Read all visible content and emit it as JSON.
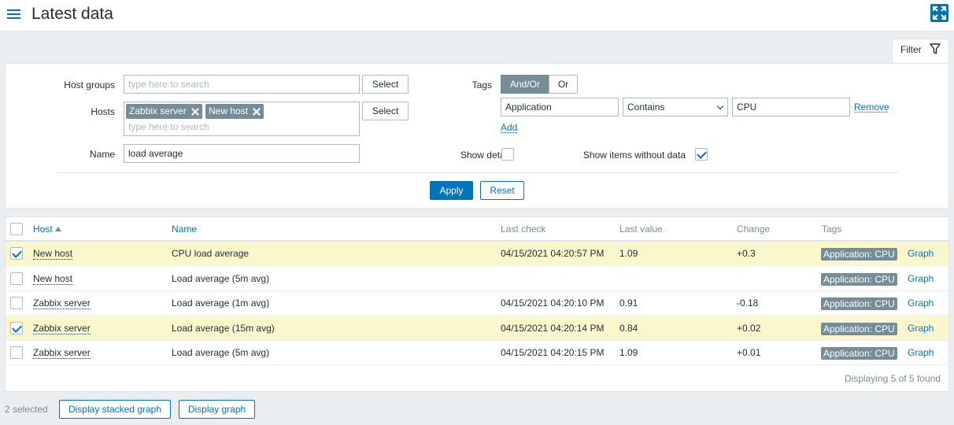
{
  "header": {
    "title": "Latest data",
    "menu_icon": "hamburger-menu-icon",
    "kiosk_icon": "fullscreen-icon"
  },
  "filter_tab": {
    "label": "Filter",
    "icon": "funnel-icon"
  },
  "filter": {
    "host_groups": {
      "label": "Host groups",
      "placeholder": "type here to search",
      "select_label": "Select"
    },
    "hosts": {
      "label": "Hosts",
      "chips": [
        "Zabbix server",
        "New host"
      ],
      "placeholder": "type here to search",
      "select_label": "Select"
    },
    "name": {
      "label": "Name",
      "value": "load average"
    },
    "tags": {
      "label": "Tags",
      "andor_label": "And/Or",
      "or_label": "Or",
      "row": {
        "tag": "Application",
        "operator": "Contains",
        "value": "CPU",
        "remove_label": "Remove"
      },
      "add_label": "Add"
    },
    "show_details": {
      "label": "Show details",
      "checked": false
    },
    "show_items_without_data": {
      "label": "Show items without data",
      "checked": true
    },
    "apply_label": "Apply",
    "reset_label": "Reset"
  },
  "table": {
    "columns": {
      "host": "Host",
      "name": "Name",
      "last_check": "Last check",
      "last_value": "Last value",
      "change": "Change",
      "tags": "Tags"
    },
    "rows": [
      {
        "selected": true,
        "host": "New host",
        "name": "CPU load average",
        "last_check": "04/15/2021 04:20:57 PM",
        "last_value": "1.09",
        "change": "+0.3",
        "tag": "Application: CPU",
        "graph": "Graph"
      },
      {
        "selected": false,
        "host": "New host",
        "name": "Load average (5m avg)",
        "last_check": "",
        "last_value": "",
        "change": "",
        "tag": "Application: CPU",
        "graph": "Graph"
      },
      {
        "selected": false,
        "host": "Zabbix server",
        "name": "Load average (1m avg)",
        "last_check": "04/15/2021 04:20:10 PM",
        "last_value": "0.91",
        "change": "-0.18",
        "tag": "Application: CPU",
        "graph": "Graph"
      },
      {
        "selected": true,
        "host": "Zabbix server",
        "name": "Load average (15m avg)",
        "last_check": "04/15/2021 04:20:14 PM",
        "last_value": "0.84",
        "change": "+0.02",
        "tag": "Application: CPU",
        "graph": "Graph"
      },
      {
        "selected": false,
        "host": "Zabbix server",
        "name": "Load average (5m avg)",
        "last_check": "04/15/2021 04:20:15 PM",
        "last_value": "1.09",
        "change": "+0.01",
        "tag": "Application: CPU",
        "graph": "Graph"
      }
    ],
    "footer": "Displaying 5 of 5 found"
  },
  "actions": {
    "selected_count": "2 selected",
    "stacked_graph_label": "Display stacked graph",
    "graph_label": "Display graph"
  }
}
